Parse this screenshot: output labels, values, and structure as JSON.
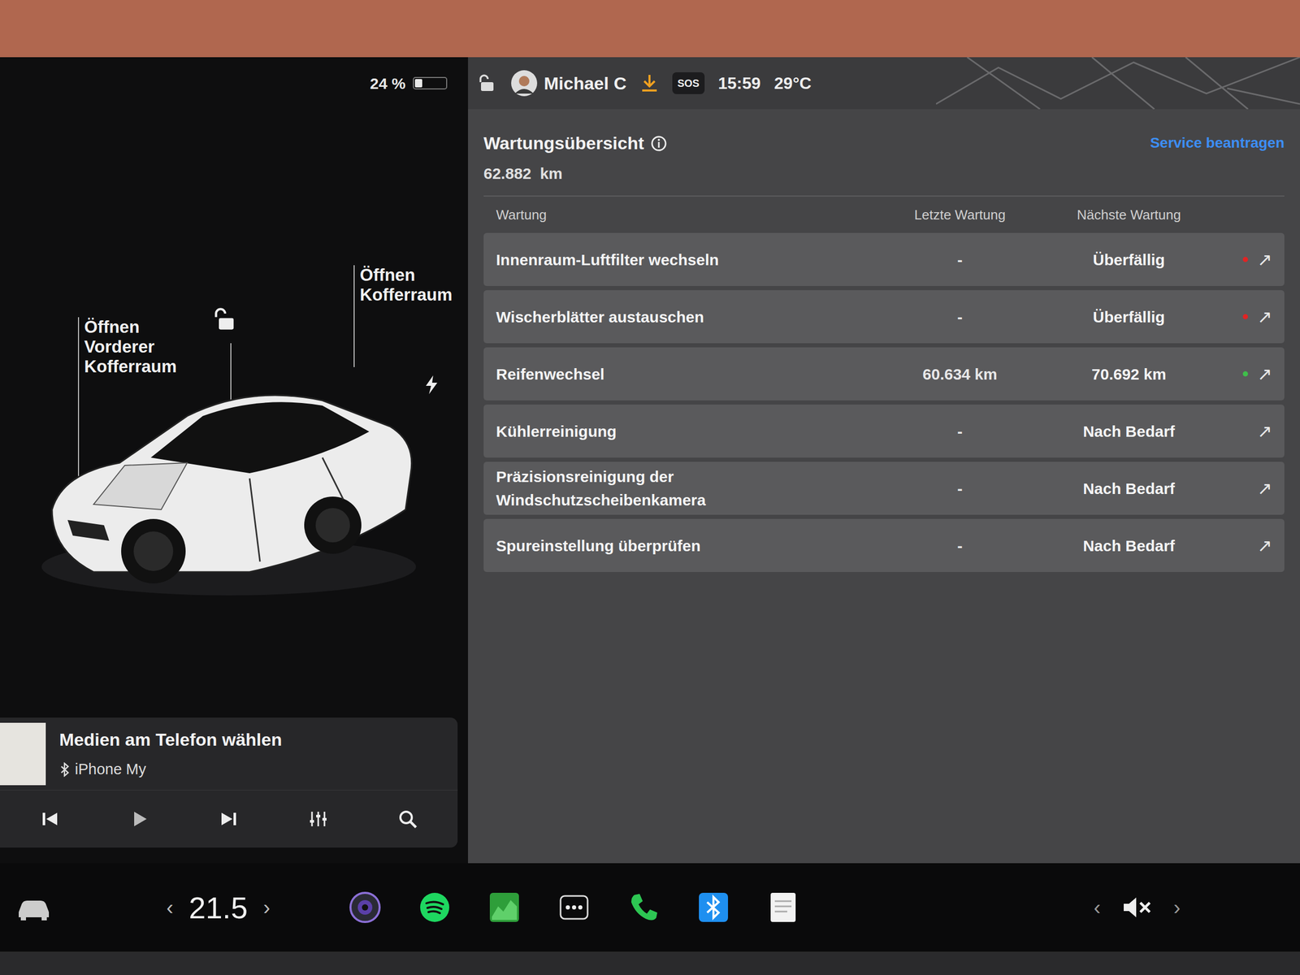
{
  "status": {
    "battery": "24 %",
    "battery_level": 0.24,
    "user": "Michael C",
    "sos": "SOS",
    "time": "15:59",
    "temperature": "29°C"
  },
  "car": {
    "locked": false,
    "labels": [
      {
        "text": "Öffnen Vorderer Kofferraum"
      },
      {
        "text": "Öffnen Kofferraum"
      }
    ]
  },
  "media": {
    "title": "Medien am Telefon wählen",
    "device": "iPhone My"
  },
  "maintenance": {
    "title": "Wartungsübersicht",
    "odometer": "62.882  km",
    "action": "Service beantragen",
    "columns": [
      "Wartung",
      "Letzte Wartung",
      "Nächste Wartung"
    ],
    "rows": [
      {
        "name": "Innenraum-Luftfilter wechseln",
        "last": "-",
        "next": "Überfällig",
        "color": "#e02424",
        "link": "↗"
      },
      {
        "name": "Wischerblätter austauschen",
        "last": "-",
        "next": "Überfällig",
        "color": "#e02424",
        "link": "↗"
      },
      {
        "name": "Reifenwechsel",
        "last": "60.634 km",
        "next": "70.692 km",
        "color": "#3fbf4a",
        "link": "↗"
      },
      {
        "name": "Kühlerreinigung",
        "last": "-",
        "next": "Nach Bedarf",
        "link": "↗"
      },
      {
        "name": "Präzisionsreinigung der Windschutzscheibenkamera",
        "last": "-",
        "next": "Nach Bedarf",
        "link": "↗"
      },
      {
        "name": "Spureinstellung überprüfen",
        "last": "-",
        "next": "Nach Bedarf",
        "link": "↗"
      }
    ]
  },
  "climate": {
    "temperature": "21.5",
    "decrease": "‹",
    "increase": "›"
  },
  "volume": {
    "muted": true,
    "decrease": "‹",
    "increase": "›"
  }
}
